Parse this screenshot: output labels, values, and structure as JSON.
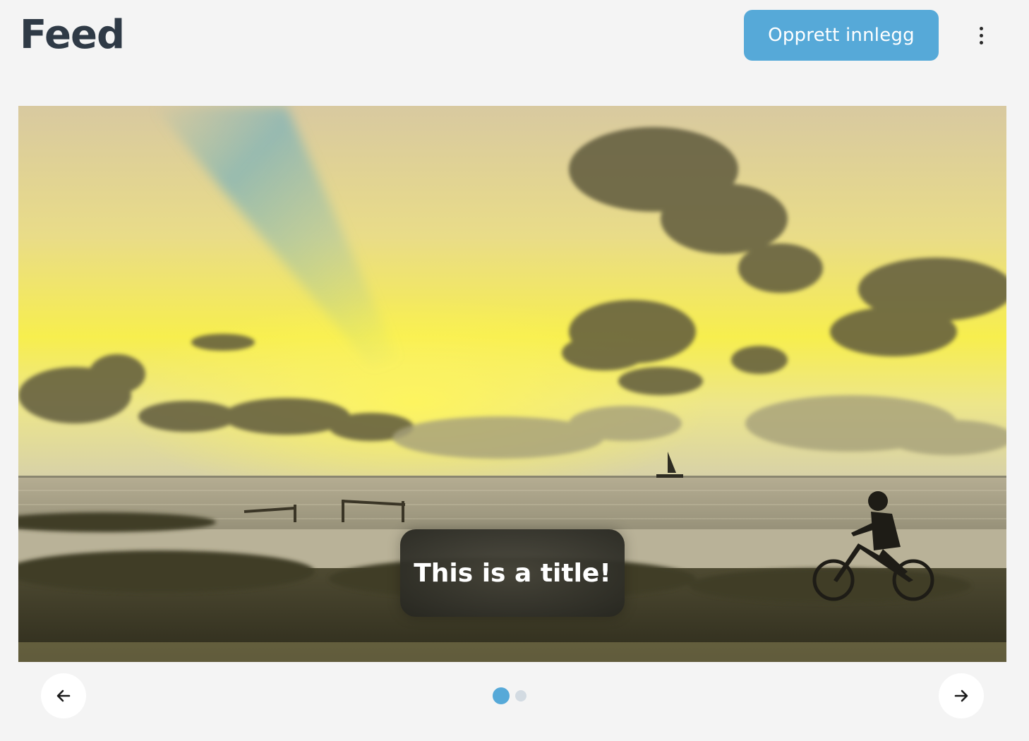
{
  "header": {
    "title": "Feed",
    "create_button_label": "Opprett innlegg",
    "more_icon": "more-vertical-icon"
  },
  "carousel": {
    "slides": [
      {
        "caption": "This is a title!",
        "image": "sunset-beach-cyclist-photo"
      }
    ],
    "pagination": {
      "total": 2,
      "active_index": 0
    },
    "prev_icon": "arrow-left-icon",
    "next_icon": "arrow-right-icon"
  },
  "colors": {
    "accent": "#56a9d8",
    "title": "#2f3a46",
    "background": "#f4f4f4"
  }
}
